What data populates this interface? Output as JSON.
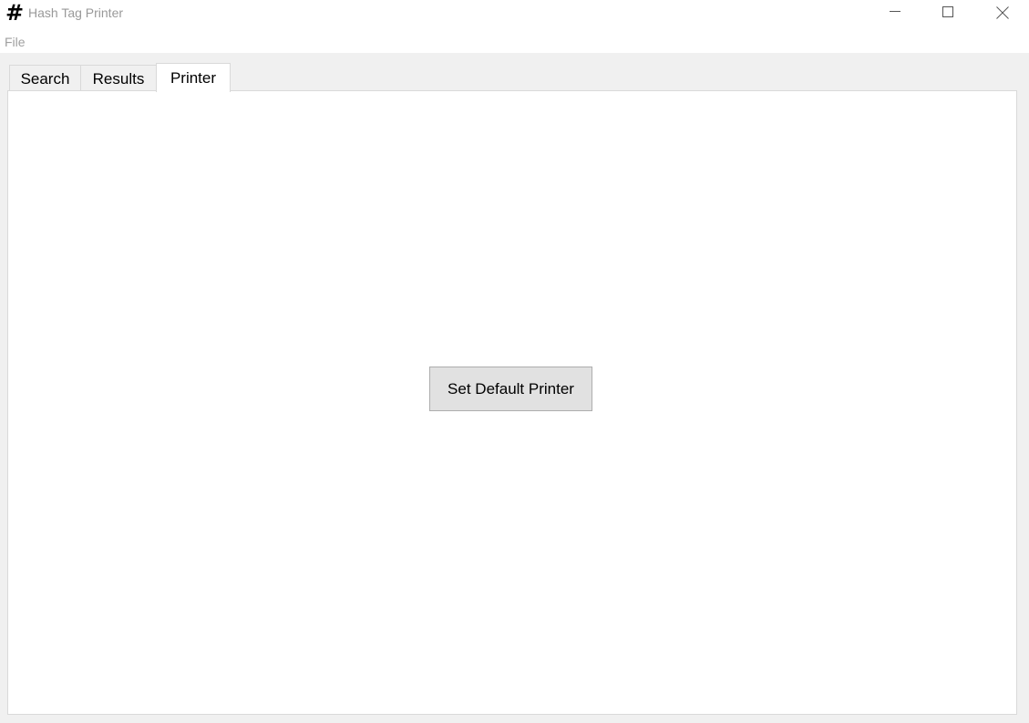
{
  "window": {
    "title": "Hash Tag Printer",
    "icon_glyph": "#",
    "icon_name": "hash-icon",
    "controls": {
      "minimize": "minimize-icon",
      "maximize": "maximize-icon",
      "close": "close-icon"
    }
  },
  "menubar": {
    "items": [
      {
        "label": "File"
      }
    ]
  },
  "tabs": [
    {
      "label": "Search",
      "active": false
    },
    {
      "label": "Results",
      "active": false
    },
    {
      "label": "Printer",
      "active": true
    }
  ],
  "printer_panel": {
    "set_default_button_label": "Set Default Printer"
  },
  "colors": {
    "window_background": "#f0f0f0",
    "panel_background": "#ffffff",
    "button_background": "#e1e1e1",
    "button_border": "#adadad",
    "disabled_text": "#a0a0a0"
  }
}
